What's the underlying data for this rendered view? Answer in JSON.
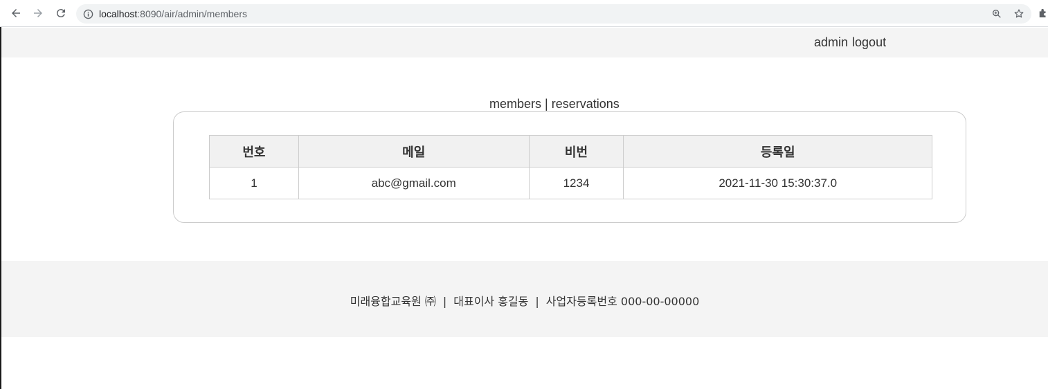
{
  "browser": {
    "url_host": "localhost",
    "url_path": ":8090/air/admin/members"
  },
  "header": {
    "admin_link": "admin",
    "logout_link": "logout"
  },
  "admin_nav": {
    "members": "members",
    "separator": "|",
    "reservations": "reservations"
  },
  "table": {
    "headers": [
      "번호",
      "메일",
      "비번",
      "등록일"
    ],
    "rows": [
      [
        "1",
        "abc@gmail.com",
        "1234",
        "2021-11-30 15:30:37.0"
      ]
    ]
  },
  "footer": {
    "company": "미래융합교육원 ㈜",
    "separator": "|",
    "ceo": "대표이사 홍길동",
    "business_no": "사업자등록번호 000-00-00000"
  },
  "colors": {
    "header_bg": "#f4f4f4",
    "footer_bg": "#f4f4f4",
    "table_header_bg": "#f1f1f1",
    "border": "#cccccc"
  }
}
